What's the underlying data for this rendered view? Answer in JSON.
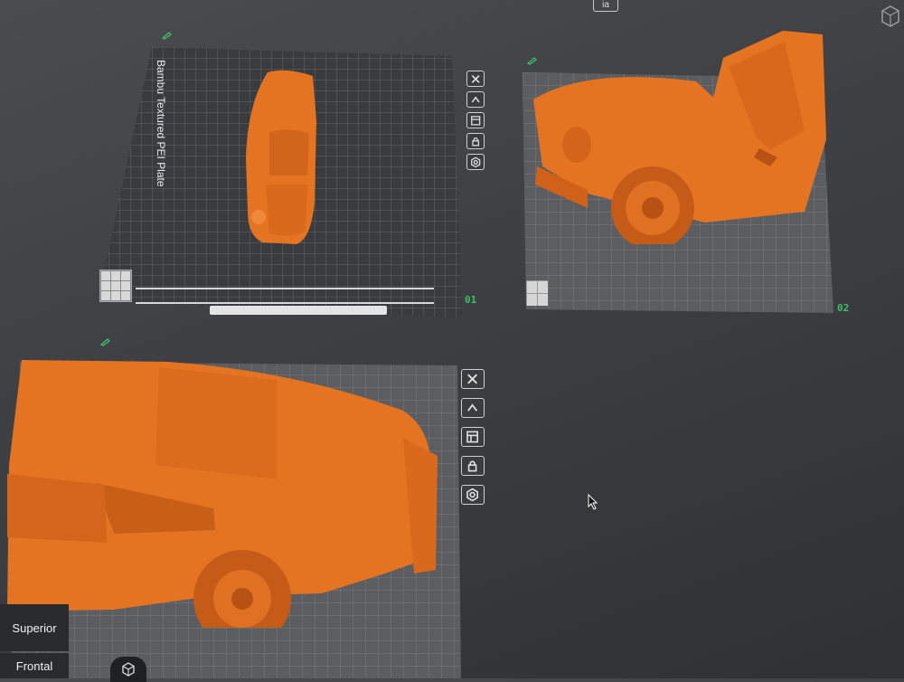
{
  "plates": [
    {
      "number": "01",
      "title": "Bambu Textured PEI Plate"
    },
    {
      "number": "02"
    }
  ],
  "view_labels": {
    "superior": "Superior",
    "frontal": "Frontal"
  },
  "top_center_label": "ia",
  "icons": [
    "close-icon",
    "auto-orient-icon",
    "arrange-icon",
    "lock-icon",
    "settings-icon",
    "edit-icon",
    "view-cube-icon",
    "mouse-cursor-icon"
  ],
  "colors": {
    "model": "#e57422",
    "plate_dark": "#3a3b3e",
    "plate_light": "#5b5d61",
    "accent": "#3fbf6a"
  }
}
